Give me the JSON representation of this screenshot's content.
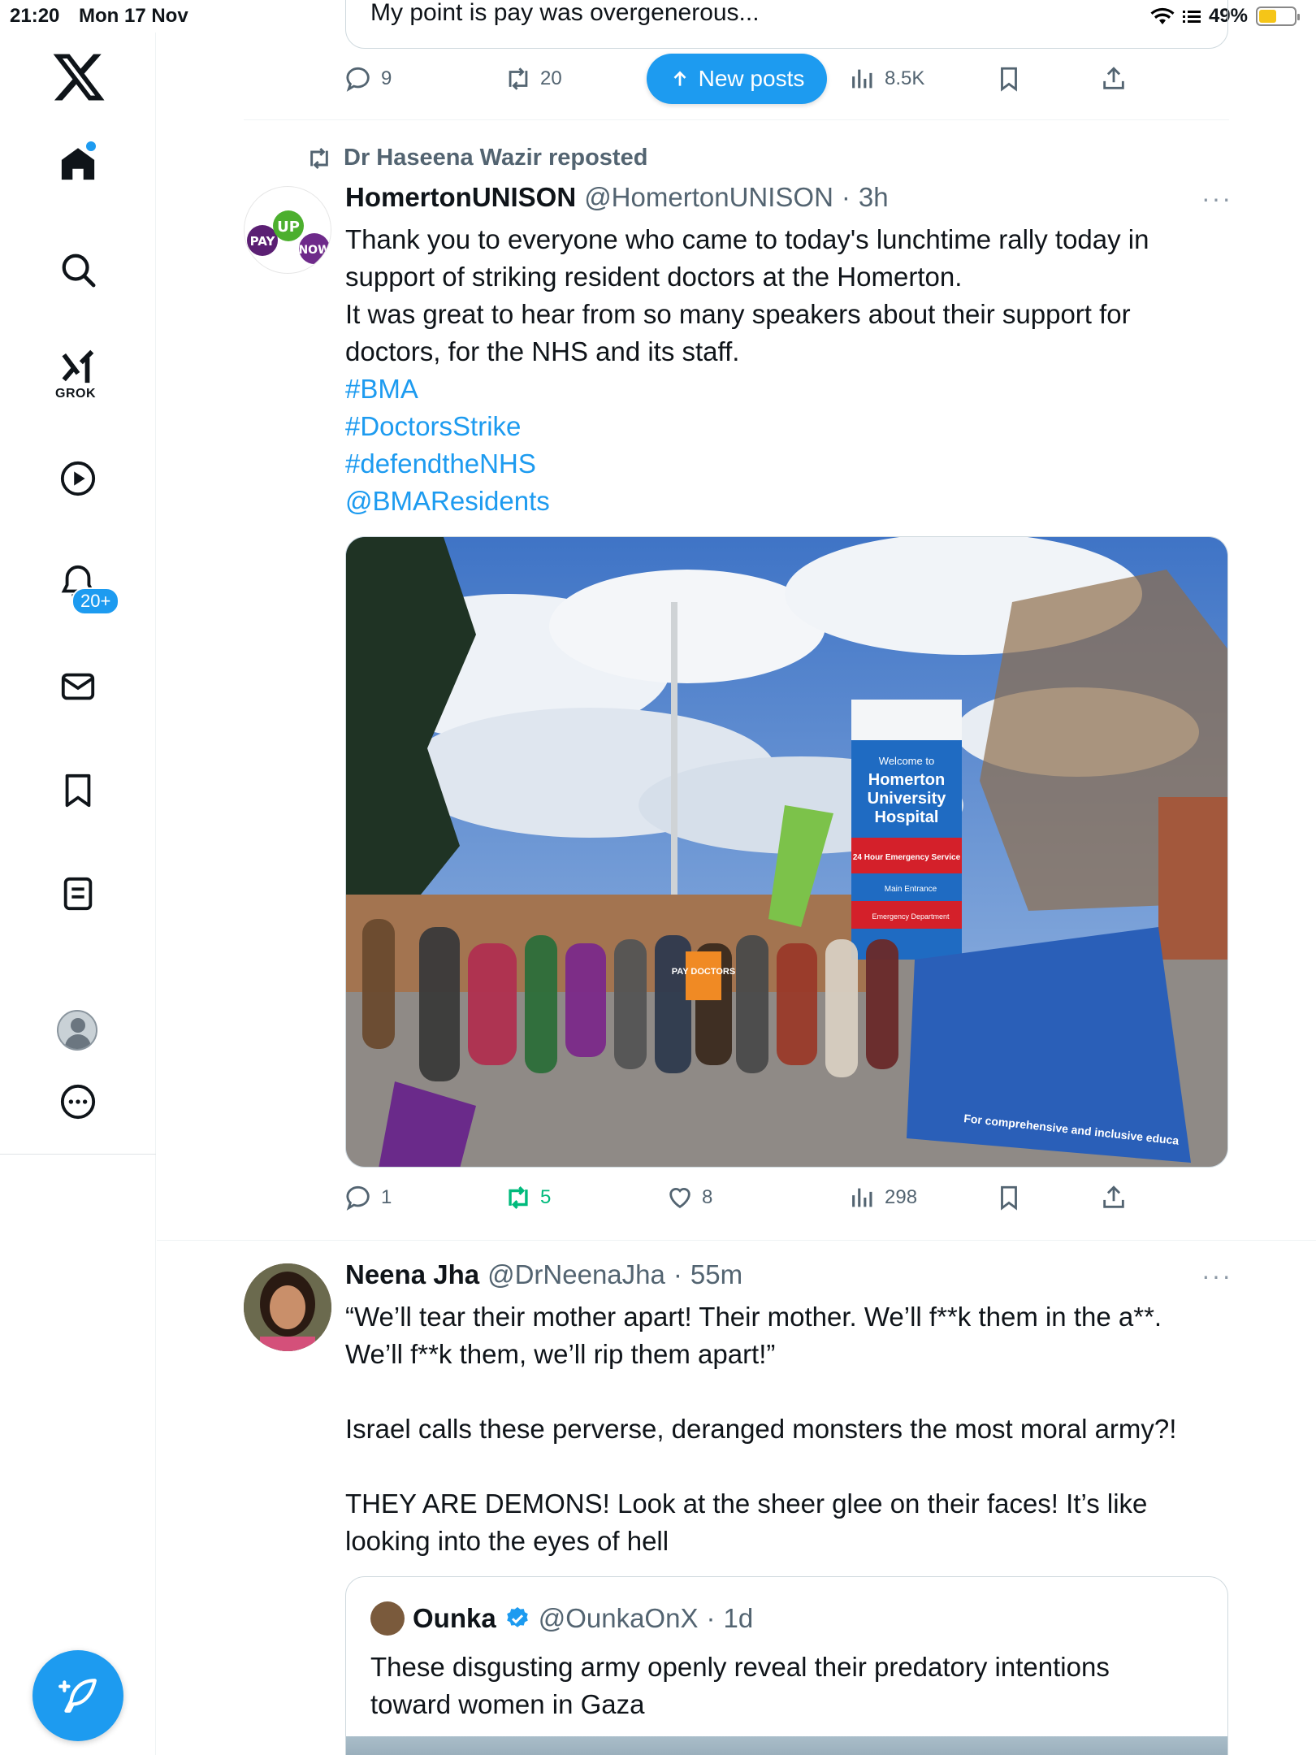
{
  "status_bar": {
    "time": "21:20",
    "date": "Mon 17 Nov",
    "battery": "49%",
    "battery_level": 0.49
  },
  "sidebar": {
    "grok_label": "GROK",
    "notifications_badge": "20+",
    "items": [
      "x-logo",
      "home",
      "search",
      "grok",
      "video",
      "notifications",
      "messages",
      "bookmarks",
      "lists",
      "profile",
      "more"
    ]
  },
  "prev_tweet": {
    "quote_text": "My point is pay was overgenerous...",
    "replies": "9",
    "reposts": "20",
    "views": "8.5K"
  },
  "new_posts_label": "New posts",
  "tweet1": {
    "repost_by": "Dr Haseena Wazir reposted",
    "name": "HomertonUNISON",
    "handle": "@HomertonUNISON",
    "time": "3h",
    "text_lines": [
      "Thank you to everyone who came to today's lunchtime rally today in",
      "support of striking resident doctors at the Homerton.",
      "It was great to hear from so many speakers about their support for",
      "doctors, for the NHS and its staff."
    ],
    "links": [
      "#BMA",
      "#DoctorsStrike",
      "#defendtheNHS",
      "@BMAResidents"
    ],
    "photo": {
      "sign_line1": "Homerton",
      "sign_line2": "University",
      "sign_line3": "Hospital",
      "sign_welcome": "Welcome to",
      "sign_emergency": "24 Hour Emergency Service",
      "sign_main": "Main Entrance",
      "sign_ed": "Emergency Department",
      "placard": "PAY DOCTORS",
      "banner": "For comprehensive and inclusive educa"
    },
    "replies": "1",
    "reposts": "5",
    "likes": "8",
    "views": "298"
  },
  "tweet2": {
    "name": "Neena Jha",
    "handle": "@DrNeenaJha",
    "time": "55m",
    "lines": [
      "“We’ll tear their mother apart! Their mother. We’ll f**k them in the a**.",
      "We’ll f**k them, we’ll rip them apart!”",
      "",
      "Israel calls these perverse, deranged monsters the most moral army?!",
      "",
      "THEY ARE DEMONS! Look at the sheer glee on their faces! It’s like",
      "looking into the eyes of hell"
    ],
    "quote": {
      "name": "Ounka",
      "handle": "@OunkaOnX",
      "time": "1d",
      "text_line1": "These disgusting army openly reveal their predatory intentions",
      "text_line2": "toward women in Gaza"
    }
  },
  "colors": {
    "accent": "#1d9bf0",
    "retweet_green": "#00ba7c",
    "secondary": "#536471"
  }
}
